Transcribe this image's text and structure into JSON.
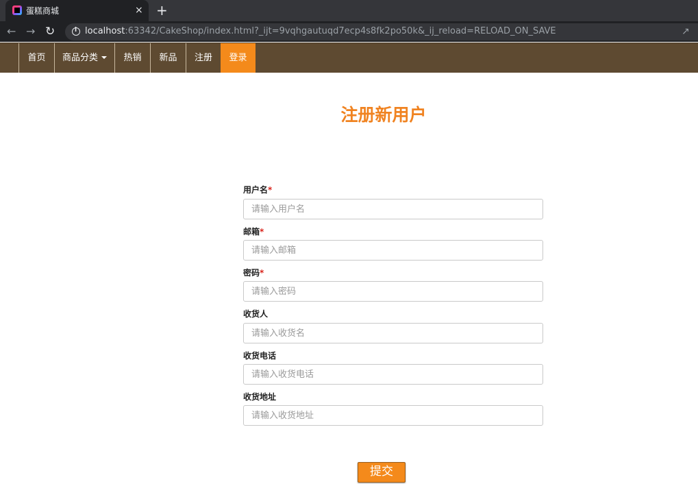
{
  "browser": {
    "tab_title": "蛋糕商城",
    "tab_close": "×",
    "new_tab": "+",
    "url_host": "localhost",
    "url_rest": ":63342/CakeShop/index.html?_ijt=9vqhgautuqd7ecp4s8fk2po50k&_ij_reload=RELOAD_ON_SAVE"
  },
  "navbar": {
    "home": "首页",
    "categories": "商品分类",
    "hot": "热销",
    "new": "新品",
    "register": "注册",
    "login": "登录"
  },
  "form": {
    "title": "注册新用户",
    "required_mark": "*",
    "fields": [
      {
        "label": "用户名",
        "placeholder": "请输入用户名"
      },
      {
        "label": "邮箱",
        "placeholder": "请输入邮箱"
      },
      {
        "label": "密码",
        "placeholder": "请输入密码"
      },
      {
        "label": "收货人",
        "placeholder": "请输入收货名"
      },
      {
        "label": "收货电话",
        "placeholder": "请输入收货电话"
      },
      {
        "label": "收货地址",
        "placeholder": "请输入收货地址"
      }
    ],
    "submit": "提交"
  },
  "colors": {
    "navbar_bg": "#5e4a31",
    "accent": "#f48a1b",
    "title": "#f08321",
    "required": "#d9251d"
  },
  "icons": [
    "favicon-icon",
    "close-icon",
    "plus-icon",
    "back-arrow-icon",
    "forward-arrow-icon",
    "reload-icon",
    "info-icon",
    "share-icon",
    "caret-down-icon"
  ]
}
